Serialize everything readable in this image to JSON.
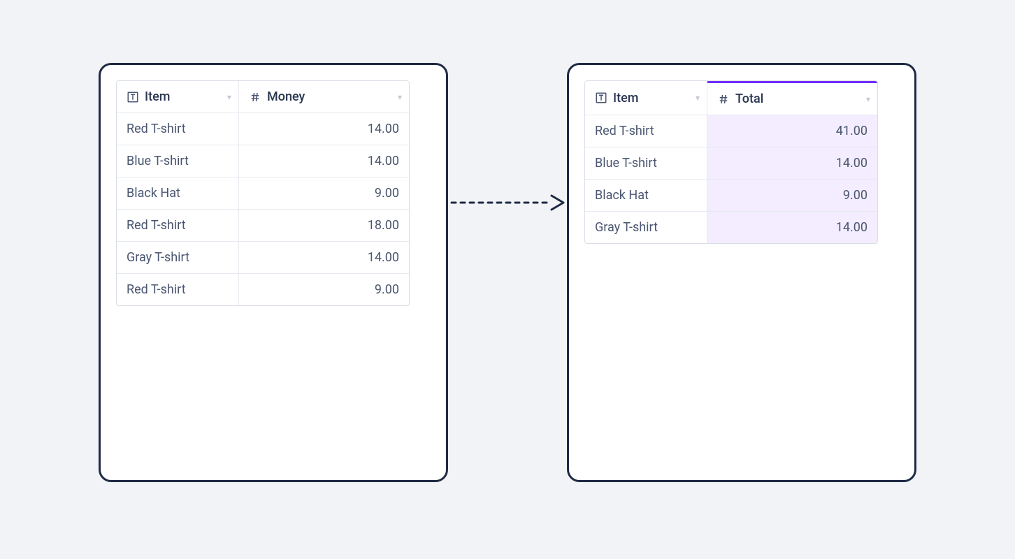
{
  "left": {
    "columns": {
      "item": "Item",
      "value": "Money"
    },
    "rows": [
      {
        "item": "Red T-shirt",
        "value": "14.00"
      },
      {
        "item": "Blue T-shirt",
        "value": "14.00"
      },
      {
        "item": "Black Hat",
        "value": "9.00"
      },
      {
        "item": "Red T-shirt",
        "value": "18.00"
      },
      {
        "item": "Gray T-shirt",
        "value": "14.00"
      },
      {
        "item": "Red T-shirt",
        "value": "9.00"
      }
    ]
  },
  "right": {
    "columns": {
      "item": "Item",
      "value": "Total"
    },
    "rows": [
      {
        "item": "Red T-shirt",
        "value": "41.00"
      },
      {
        "item": "Blue T-shirt",
        "value": "14.00"
      },
      {
        "item": "Black Hat",
        "value": "9.00"
      },
      {
        "item": "Gray T-shirt",
        "value": "14.00"
      }
    ]
  }
}
